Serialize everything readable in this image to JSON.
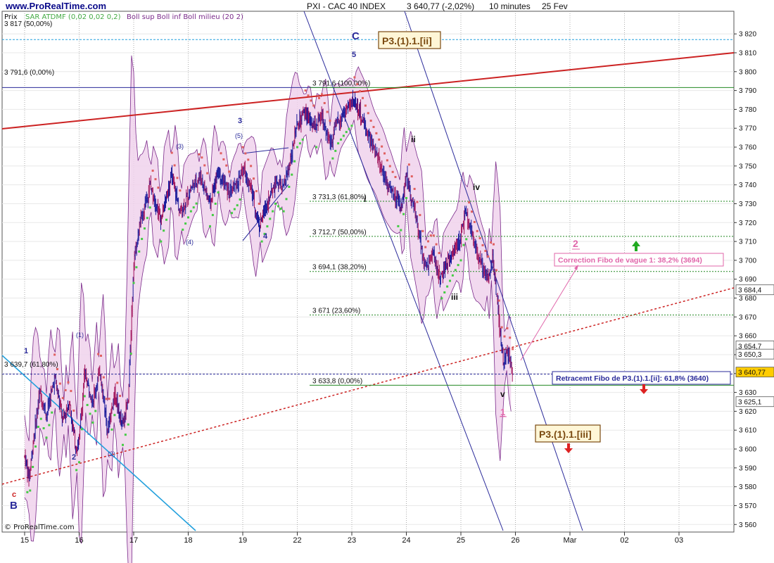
{
  "header": {
    "site": "www.ProRealTime.com",
    "title": "PXI - CAC 40 INDEX",
    "last_price": "3 640,77 (-2,02%)",
    "timeframe": "10 minutes",
    "date": "25 Fev",
    "price_label": "Prix",
    "indicator1": "SAR ATDMF (0,02 0,02 0,2)",
    "indicator2": "Boll sup Boll inf Boll milieu (20 2)",
    "copyright": "© ProRealTime.com"
  },
  "chart_data": {
    "type": "candlestick",
    "ylim": [
      3556,
      3832
    ],
    "y_ticks": [
      3560,
      3570,
      3580,
      3590,
      3600,
      3610,
      3620,
      3630,
      3640,
      3650,
      3660,
      3670,
      3680,
      3690,
      3700,
      3710,
      3720,
      3730,
      3740,
      3750,
      3760,
      3770,
      3780,
      3790,
      3800,
      3810,
      3820
    ],
    "y_tick_labels": [
      "3 560",
      "3 570",
      "3 580",
      "3 590",
      "3 600",
      "3 610",
      "3 620",
      "3 630",
      "3 640",
      "3 650",
      "3 660",
      "3 670",
      "3 680",
      "3 690",
      "3 700",
      "3 710",
      "3 720",
      "3 730",
      "3 740",
      "3 750",
      "3 760",
      "3 770",
      "3 780",
      "3 790",
      "3 800",
      "3 810",
      "3 820"
    ],
    "x_tick_labels": [
      "15",
      "16",
      "17",
      "18",
      "19",
      "22",
      "23",
      "24",
      "25",
      "26",
      "Mar",
      "02",
      "03"
    ],
    "x_slots": [
      0,
      1,
      2,
      3,
      4,
      5,
      6,
      7,
      8,
      9,
      10,
      11,
      12
    ],
    "price_path": [
      [
        0.0,
        3596
      ],
      [
        0.08,
        3585
      ],
      [
        0.16,
        3605
      ],
      [
        0.28,
        3630
      ],
      [
        0.4,
        3618
      ],
      [
        0.55,
        3638
      ],
      [
        0.7,
        3615
      ],
      [
        0.82,
        3625
      ],
      [
        0.94,
        3600
      ],
      [
        1.0,
        3605
      ],
      [
        1.1,
        3640
      ],
      [
        1.25,
        3626
      ],
      [
        1.38,
        3642
      ],
      [
        1.52,
        3610
      ],
      [
        1.65,
        3630
      ],
      [
        1.78,
        3612
      ],
      [
        1.9,
        3625
      ],
      [
        2.0,
        3700
      ],
      [
        2.12,
        3720
      ],
      [
        2.3,
        3740
      ],
      [
        2.5,
        3722
      ],
      [
        2.7,
        3745
      ],
      [
        2.85,
        3725
      ],
      [
        3.05,
        3738
      ],
      [
        3.22,
        3745
      ],
      [
        3.4,
        3730
      ],
      [
        3.55,
        3748
      ],
      [
        3.75,
        3735
      ],
      [
        3.92,
        3742
      ],
      [
        4.0,
        3748
      ],
      [
        4.15,
        3738
      ],
      [
        4.3,
        3718
      ],
      [
        4.45,
        3730
      ],
      [
        4.6,
        3742
      ],
      [
        4.75,
        3738
      ],
      [
        4.92,
        3760
      ],
      [
        5.0,
        3772
      ],
      [
        5.15,
        3778
      ],
      [
        5.3,
        3770
      ],
      [
        5.45,
        3776
      ],
      [
        5.6,
        3762
      ],
      [
        5.75,
        3774
      ],
      [
        5.9,
        3780
      ],
      [
        6.05,
        3785
      ],
      [
        6.2,
        3774
      ],
      [
        6.35,
        3762
      ],
      [
        6.5,
        3752
      ],
      [
        6.65,
        3741
      ],
      [
        6.78,
        3733
      ],
      [
        6.9,
        3728
      ],
      [
        7.0,
        3745
      ],
      [
        7.12,
        3730
      ],
      [
        7.25,
        3712
      ],
      [
        7.35,
        3695
      ],
      [
        7.48,
        3703
      ],
      [
        7.62,
        3690
      ],
      [
        7.78,
        3700
      ],
      [
        7.92,
        3708
      ],
      [
        8.0,
        3712
      ],
      [
        8.08,
        3725
      ],
      [
        8.18,
        3716
      ],
      [
        8.28,
        3705
      ],
      [
        8.4,
        3696
      ],
      [
        8.5,
        3690
      ],
      [
        8.58,
        3702
      ],
      [
        8.66,
        3680
      ],
      [
        8.72,
        3660
      ],
      [
        8.78,
        3645
      ],
      [
        8.84,
        3653
      ],
      [
        8.9,
        3647
      ],
      [
        8.95,
        3641
      ]
    ],
    "annotations": {
      "top_line_label": "3 817 (50,00%)",
      "left_fib_label": "3 791,6 (0,00%)",
      "left_618_label": "3 639,7 (61,80%)",
      "fib_levels": [
        {
          "value": 3791.6,
          "label": "3 791,6 (100,00%)"
        },
        {
          "value": 3731.3,
          "label": "3 731,3 (61,80%)"
        },
        {
          "value": 3712.7,
          "label": "3 712,7 (50,00%)"
        },
        {
          "value": 3694.1,
          "label": "3 694,1 (38,20%)"
        },
        {
          "value": 3671,
          "label": "3 671 (23,60%)"
        },
        {
          "value": 3633.8,
          "label": "3 633,8 (0,00%)"
        }
      ],
      "right_labels": [
        {
          "value": 3684.4,
          "text": "3 684,4",
          "color": "#ffffff"
        },
        {
          "value": 3654.7,
          "text": "3 654,7",
          "color": "#ffffff"
        },
        {
          "value": 3650.3,
          "text": "3 650,3",
          "color": "#ffffff"
        },
        {
          "value": 3640.77,
          "text": "3 640,77",
          "color": "#ffcc00"
        },
        {
          "value": 3625.1,
          "text": "3 625,1",
          "color": "#ffffff"
        }
      ],
      "box_correction": "Correction Fibo de vague 1: 38,2% (3694)",
      "box_retracement": "Retracemt Fibo de P3.(1).1.[ii]: 61,8% (3640)",
      "box_p3_ii": "P3.(1).1.[ii]",
      "box_p3_iii": "P3.(1).1.[iii]",
      "waves": {
        "C": "C",
        "five": "5",
        "B": "B",
        "c_small": "c",
        "one_blue": "1",
        "two_blue": "2",
        "three_blue": "3",
        "four_blue": "4",
        "p1": "(1)",
        "p2": "(2)",
        "p3": "(3)",
        "p4": "(4)",
        "p5": "(5)",
        "i": "i",
        "ii": "ii",
        "iii": "iii",
        "iv": "iv",
        "v": "v",
        "pink1": "1",
        "pink2": "2"
      }
    },
    "colors": {
      "candle": "#1a1a9a",
      "candle_alt": "#a0125a",
      "bollinger_fill": "#f0d2ec",
      "bollinger_line": "#7a2a8a",
      "sar_up": "#44cc44",
      "sar_down": "#e06060",
      "trend_red": "#cc2222",
      "trend_blue": "#22a0dd",
      "channel": "#2a2a9a",
      "fib_green": "#228822",
      "grid": "#9a9a9a",
      "pink": "#e066aa",
      "brown": "#7a4a10"
    },
    "grid": true
  }
}
